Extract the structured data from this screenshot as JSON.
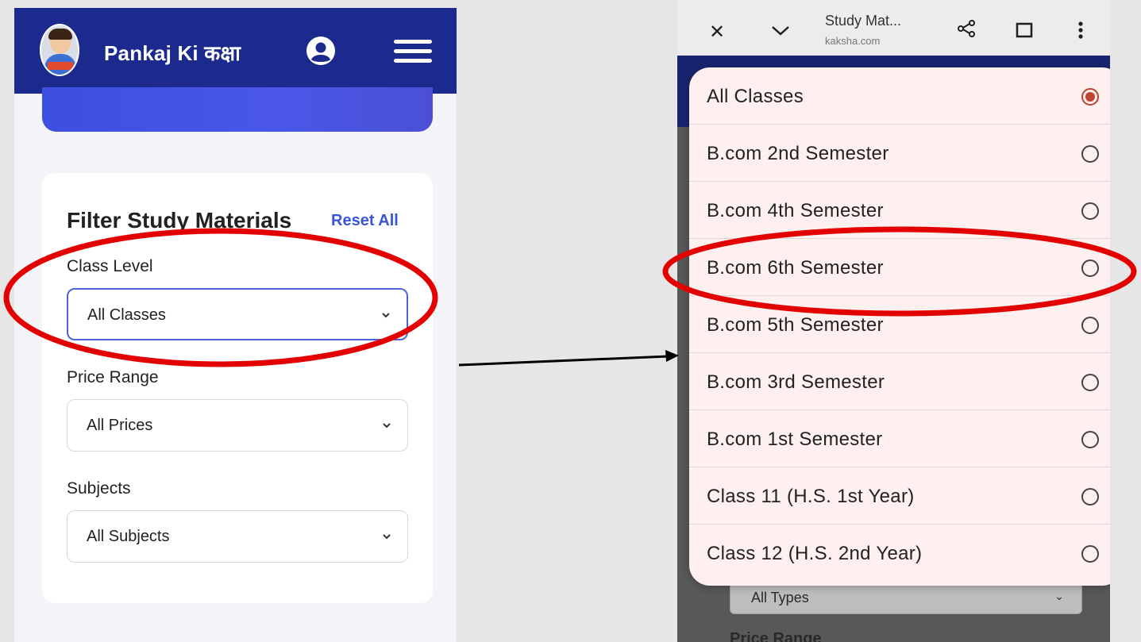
{
  "left": {
    "header": {
      "brand": "Pankaj Ki कक्षा",
      "brand_color": "#1b2a8c"
    },
    "filter": {
      "title": "Filter Study Materials",
      "reset_label": "Reset All",
      "fields": [
        {
          "label": "Class Level",
          "value": "All Classes"
        },
        {
          "label": "Price Range",
          "value": "All Prices"
        },
        {
          "label": "Subjects",
          "value": "All Subjects"
        }
      ]
    }
  },
  "right": {
    "browser": {
      "tab_title": "Study Mat...",
      "tab_url": "kaksha.com"
    },
    "picker": {
      "options": [
        {
          "label": "All Classes",
          "selected": true
        },
        {
          "label": "B.com 2nd Semester",
          "selected": false
        },
        {
          "label": "B.com 4th Semester",
          "selected": false
        },
        {
          "label": "B.com 6th Semester",
          "selected": false
        },
        {
          "label": "B.com 5th Semester",
          "selected": false
        },
        {
          "label": "B.com 3rd Semester",
          "selected": false
        },
        {
          "label": "B.com 1st Semester",
          "selected": false
        },
        {
          "label": "Class 11 (H.S. 1st Year)",
          "selected": false
        },
        {
          "label": "Class 12 (H.S. 2nd Year)",
          "selected": false
        }
      ]
    },
    "background": {
      "type_select_value": "All Types",
      "next_label": "Price Range"
    }
  },
  "colors": {
    "highlight": "#e30000",
    "radio_selected": "#c0432f",
    "link": "#3a55d4"
  }
}
